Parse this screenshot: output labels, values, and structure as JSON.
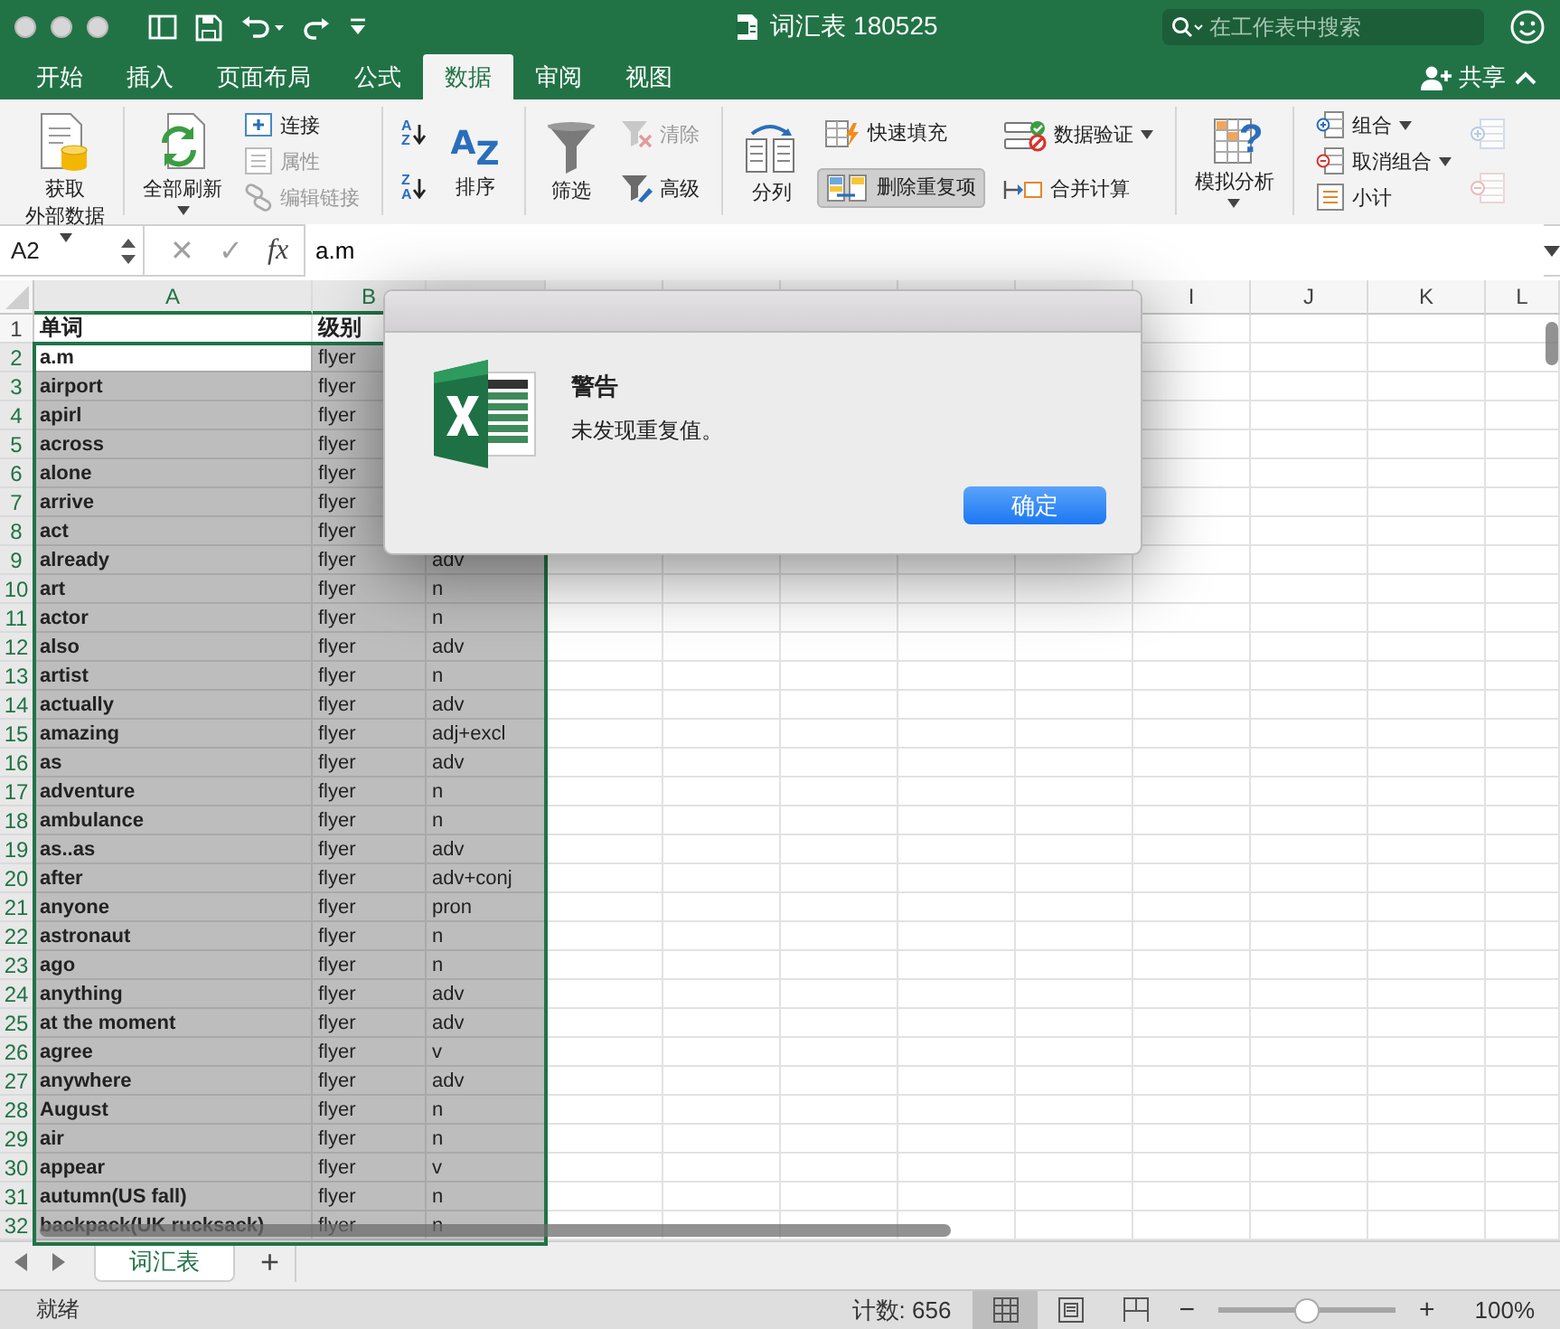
{
  "window": {
    "title": "词汇表 180525"
  },
  "search": {
    "placeholder": "在工作表中搜索"
  },
  "tabs": [
    {
      "label": "开始",
      "selected": false
    },
    {
      "label": "插入",
      "selected": false
    },
    {
      "label": "页面布局",
      "selected": false
    },
    {
      "label": "公式",
      "selected": false
    },
    {
      "label": "数据",
      "selected": true
    },
    {
      "label": "审阅",
      "selected": false
    },
    {
      "label": "视图",
      "selected": false
    }
  ],
  "share": {
    "label": "共享"
  },
  "ribbon": {
    "groups": [
      {
        "columns": [
          [
            {
              "kind": "large",
              "label_lines": [
                "获取",
                "外部数据"
              ],
              "dropdown": true,
              "disabled": false,
              "pressed": false
            }
          ]
        ]
      },
      {
        "columns": [
          [
            {
              "kind": "large",
              "label": "全部刷新",
              "dropdown": true,
              "disabled": false,
              "pressed": false
            }
          ],
          [
            {
              "kind": "small",
              "label": "连接",
              "dropdown": false,
              "disabled": false,
              "pressed": false
            },
            {
              "kind": "small",
              "label": "属性",
              "dropdown": false,
              "disabled": true,
              "pressed": false
            },
            {
              "kind": "small",
              "label": "编辑链接",
              "dropdown": false,
              "disabled": true,
              "pressed": false
            }
          ]
        ]
      },
      {
        "columns": [
          [
            {
              "kind": "sort",
              "icon_text": [
                "A",
                "Z"
              ]
            },
            {
              "kind": "sort",
              "icon_text": [
                "Z",
                "A"
              ]
            }
          ],
          [
            {
              "kind": "bigsort",
              "label": "排序",
              "icon_text": [
                "A",
                "Z"
              ],
              "disabled": false,
              "pressed": false
            }
          ]
        ]
      },
      {
        "columns": [
          [
            {
              "kind": "large",
              "label": "筛选",
              "dropdown": false,
              "disabled": false,
              "pressed": false
            }
          ],
          [
            {
              "kind": "small",
              "label": "清除",
              "dropdown": false,
              "disabled": true,
              "pressed": false
            },
            {
              "kind": "small",
              "label": "高级",
              "dropdown": false,
              "disabled": false,
              "pressed": false
            }
          ]
        ]
      },
      {
        "columns": [
          [
            {
              "kind": "large",
              "label": "分列",
              "dropdown": false,
              "disabled": false,
              "pressed": false
            }
          ],
          [
            {
              "kind": "small",
              "label": "快速填充",
              "dropdown": false,
              "disabled": false,
              "pressed": false
            },
            {
              "kind": "small",
              "label": "删除重复项",
              "dropdown": false,
              "disabled": false,
              "pressed": true
            }
          ],
          [
            {
              "kind": "small",
              "label": "数据验证",
              "dropdown": true,
              "disabled": false,
              "pressed": false
            },
            {
              "kind": "small",
              "label": "合并计算",
              "dropdown": false,
              "disabled": false,
              "pressed": false
            }
          ]
        ]
      },
      {
        "columns": [
          [
            {
              "kind": "large",
              "label": "模拟分析",
              "icon_text": [
                "?"
              ],
              "dropdown": true,
              "disabled": false,
              "pressed": false
            }
          ]
        ]
      },
      {
        "columns": [
          [
            {
              "kind": "small",
              "label": "组合",
              "dropdown": true,
              "disabled": false,
              "pressed": false
            },
            {
              "kind": "small",
              "label": "取消组合",
              "dropdown": true,
              "disabled": false,
              "pressed": false
            },
            {
              "kind": "small",
              "label": "小计",
              "dropdown": false,
              "disabled": false,
              "pressed": false
            }
          ],
          [
            {
              "kind": "icon",
              "disabled": true
            },
            {
              "kind": "icon",
              "disabled": true
            }
          ]
        ]
      }
    ]
  },
  "formula_bar": {
    "name_box": "A2",
    "cancel": "✕",
    "enter": "✓",
    "function_label": "fx",
    "formula": "a.m"
  },
  "sheet": {
    "columns": [
      {
        "label": "A",
        "selected": true
      },
      {
        "label": "B",
        "selected": true
      },
      {
        "label": "I",
        "selected": false
      },
      {
        "label": "J",
        "selected": false
      },
      {
        "label": "K",
        "selected": false
      },
      {
        "label": "L",
        "selected": false
      }
    ],
    "rows": [
      {
        "number": "1",
        "cells": [
          "单词",
          "级别"
        ],
        "selected": false,
        "active": false
      },
      {
        "number": "2",
        "cells": [
          "a.m",
          "flyer"
        ],
        "selected": true,
        "active": true
      },
      {
        "number": "3",
        "cells": [
          "airport",
          "flyer"
        ],
        "selected": true,
        "active": false
      },
      {
        "number": "4",
        "cells": [
          "apirl",
          "flyer"
        ],
        "selected": true,
        "active": false
      },
      {
        "number": "5",
        "cells": [
          "across",
          "flyer"
        ],
        "selected": true,
        "active": false
      },
      {
        "number": "6",
        "cells": [
          "alone",
          "flyer"
        ],
        "selected": true,
        "active": false
      },
      {
        "number": "7",
        "cells": [
          "arrive",
          "flyer"
        ],
        "selected": true,
        "active": false
      },
      {
        "number": "8",
        "cells": [
          "act",
          "flyer"
        ],
        "selected": true,
        "active": false
      },
      {
        "number": "9",
        "cells": [
          "already",
          "flyer",
          "adv"
        ],
        "selected": true,
        "active": false
      },
      {
        "number": "10",
        "cells": [
          "art",
          "flyer",
          "n"
        ],
        "selected": true,
        "active": false
      },
      {
        "number": "11",
        "cells": [
          "actor",
          "flyer",
          "n"
        ],
        "selected": true,
        "active": false
      },
      {
        "number": "12",
        "cells": [
          "also",
          "flyer",
          "adv"
        ],
        "selected": true,
        "active": false
      },
      {
        "number": "13",
        "cells": [
          "artist",
          "flyer",
          "n"
        ],
        "selected": true,
        "active": false
      },
      {
        "number": "14",
        "cells": [
          "actually",
          "flyer",
          "adv"
        ],
        "selected": true,
        "active": false
      },
      {
        "number": "15",
        "cells": [
          "amazing",
          "flyer",
          "adj+excl"
        ],
        "selected": true,
        "active": false
      },
      {
        "number": "16",
        "cells": [
          "as",
          "flyer",
          "adv"
        ],
        "selected": true,
        "active": false
      },
      {
        "number": "17",
        "cells": [
          "adventure",
          "flyer",
          "n"
        ],
        "selected": true,
        "active": false
      },
      {
        "number": "18",
        "cells": [
          "ambulance",
          "flyer",
          "n"
        ],
        "selected": true,
        "active": false
      },
      {
        "number": "19",
        "cells": [
          "as..as",
          "flyer",
          "adv"
        ],
        "selected": true,
        "active": false
      },
      {
        "number": "20",
        "cells": [
          "after",
          "flyer",
          "adv+conj"
        ],
        "selected": true,
        "active": false
      },
      {
        "number": "21",
        "cells": [
          "anyone",
          "flyer",
          "pron"
        ],
        "selected": true,
        "active": false
      },
      {
        "number": "22",
        "cells": [
          "astronaut",
          "flyer",
          "n"
        ],
        "selected": true,
        "active": false
      },
      {
        "number": "23",
        "cells": [
          "ago",
          "flyer",
          "n"
        ],
        "selected": true,
        "active": false
      },
      {
        "number": "24",
        "cells": [
          "anything",
          "flyer",
          "adv"
        ],
        "selected": true,
        "active": false
      },
      {
        "number": "25",
        "cells": [
          "at the moment",
          "flyer",
          "adv"
        ],
        "selected": true,
        "active": false
      },
      {
        "number": "26",
        "cells": [
          "agree",
          "flyer",
          "v"
        ],
        "selected": true,
        "active": false
      },
      {
        "number": "27",
        "cells": [
          "anywhere",
          "flyer",
          "adv"
        ],
        "selected": true,
        "active": false
      },
      {
        "number": "28",
        "cells": [
          "August",
          "flyer",
          "n"
        ],
        "selected": true,
        "active": false
      },
      {
        "number": "29",
        "cells": [
          "air",
          "flyer",
          "n"
        ],
        "selected": true,
        "active": false
      },
      {
        "number": "30",
        "cells": [
          "appear",
          "flyer",
          "v"
        ],
        "selected": true,
        "active": false
      },
      {
        "number": "31",
        "cells": [
          "autumn(US fall)",
          "flyer",
          "n"
        ],
        "selected": true,
        "active": false
      },
      {
        "number": "32",
        "cells": [
          "backpack(UK rucksack)",
          "flyer",
          "n"
        ],
        "selected": true,
        "active": false
      }
    ]
  },
  "dialog": {
    "title": "警告",
    "message": "未发现重复值。",
    "button": "确定"
  },
  "sheet_tabs": {
    "tabs": [
      {
        "label": "词汇表",
        "selected": true
      }
    ],
    "add": "+"
  },
  "status_bar": {
    "status": "就绪",
    "count": "计数: 656",
    "views": [
      {
        "selected": true
      },
      {
        "selected": false
      },
      {
        "selected": false
      }
    ],
    "zoom_out": "−",
    "zoom_in": "+",
    "zoom": {
      "level": 0.5
    },
    "zoom_reading": "100%"
  }
}
